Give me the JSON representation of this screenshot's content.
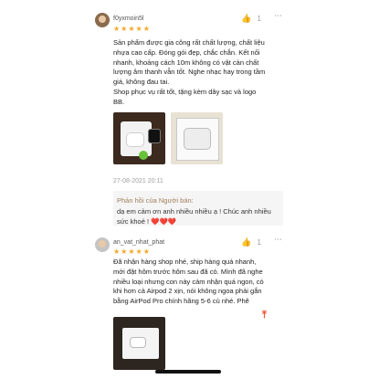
{
  "reviews": [
    {
      "username": "f0yxmoin5l",
      "likes": "1",
      "rating_stars": "★★★★★",
      "lines": [
        "Sản phẩm được gia công rất chất lượng, chất liệu",
        "nhựa cao cấp. Đóng gói đẹp, chắc chắn. Kết nối",
        "nhanh, khoảng cách 10m không có vật cản chất",
        "lượng âm thanh vẫn tốt. Nghe nhạc hay trong tầm",
        "giá, không đau tai.",
        "Shop phục  vụ rất tốt, tặng kèm dây sạc và logo",
        "BB."
      ],
      "date": "27-08-2021 20:11",
      "seller_reply_title": "Phản hồi của Người bán:",
      "seller_reply_text": "dạ em cảm ơn anh nhiều nhiều ạ ! Chúc anh nhiều sức khoẻ !",
      "seller_reply_hearts": "❤️❤️❤️"
    },
    {
      "username": "an_vat_nhat_phat",
      "likes": "1",
      "rating_stars": "★★★★★",
      "lines": [
        "Đã nhận hàng shop nhé, ship hàng quá nhanh,",
        "mới đặt hôm trước hôm sau đã có. Mình đã nghe",
        "nhiều loại nhưng con này cảm nhận quá ngon, có",
        "khi hơn cả Airpod 2 xịn, nói không ngoa phải gắn",
        "bằng AirPod Pro chính hãng 5-6 củ nhé. Phê"
      ]
    }
  ],
  "icons": {
    "like": "👍",
    "more": "⋯",
    "scroll_top": "⤒"
  },
  "colors": {
    "star": "#f5a623",
    "accent": "#ee4d2d",
    "seller_title": "#a07e5a",
    "heart": "#e0453c"
  }
}
